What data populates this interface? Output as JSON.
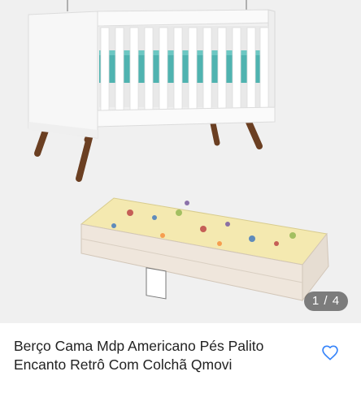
{
  "product": {
    "title": "Berço Cama Mdp Americano Pés Palito Encanto Retrô Com Colchã Qmovi"
  },
  "gallery": {
    "counter": "1 / 4"
  },
  "colors": {
    "favorite_icon": "#3483fa",
    "counter_bg": "#555555",
    "mattress_accent": "#4fb3b0"
  },
  "icons": {
    "favorite": "heart-outline-icon"
  }
}
